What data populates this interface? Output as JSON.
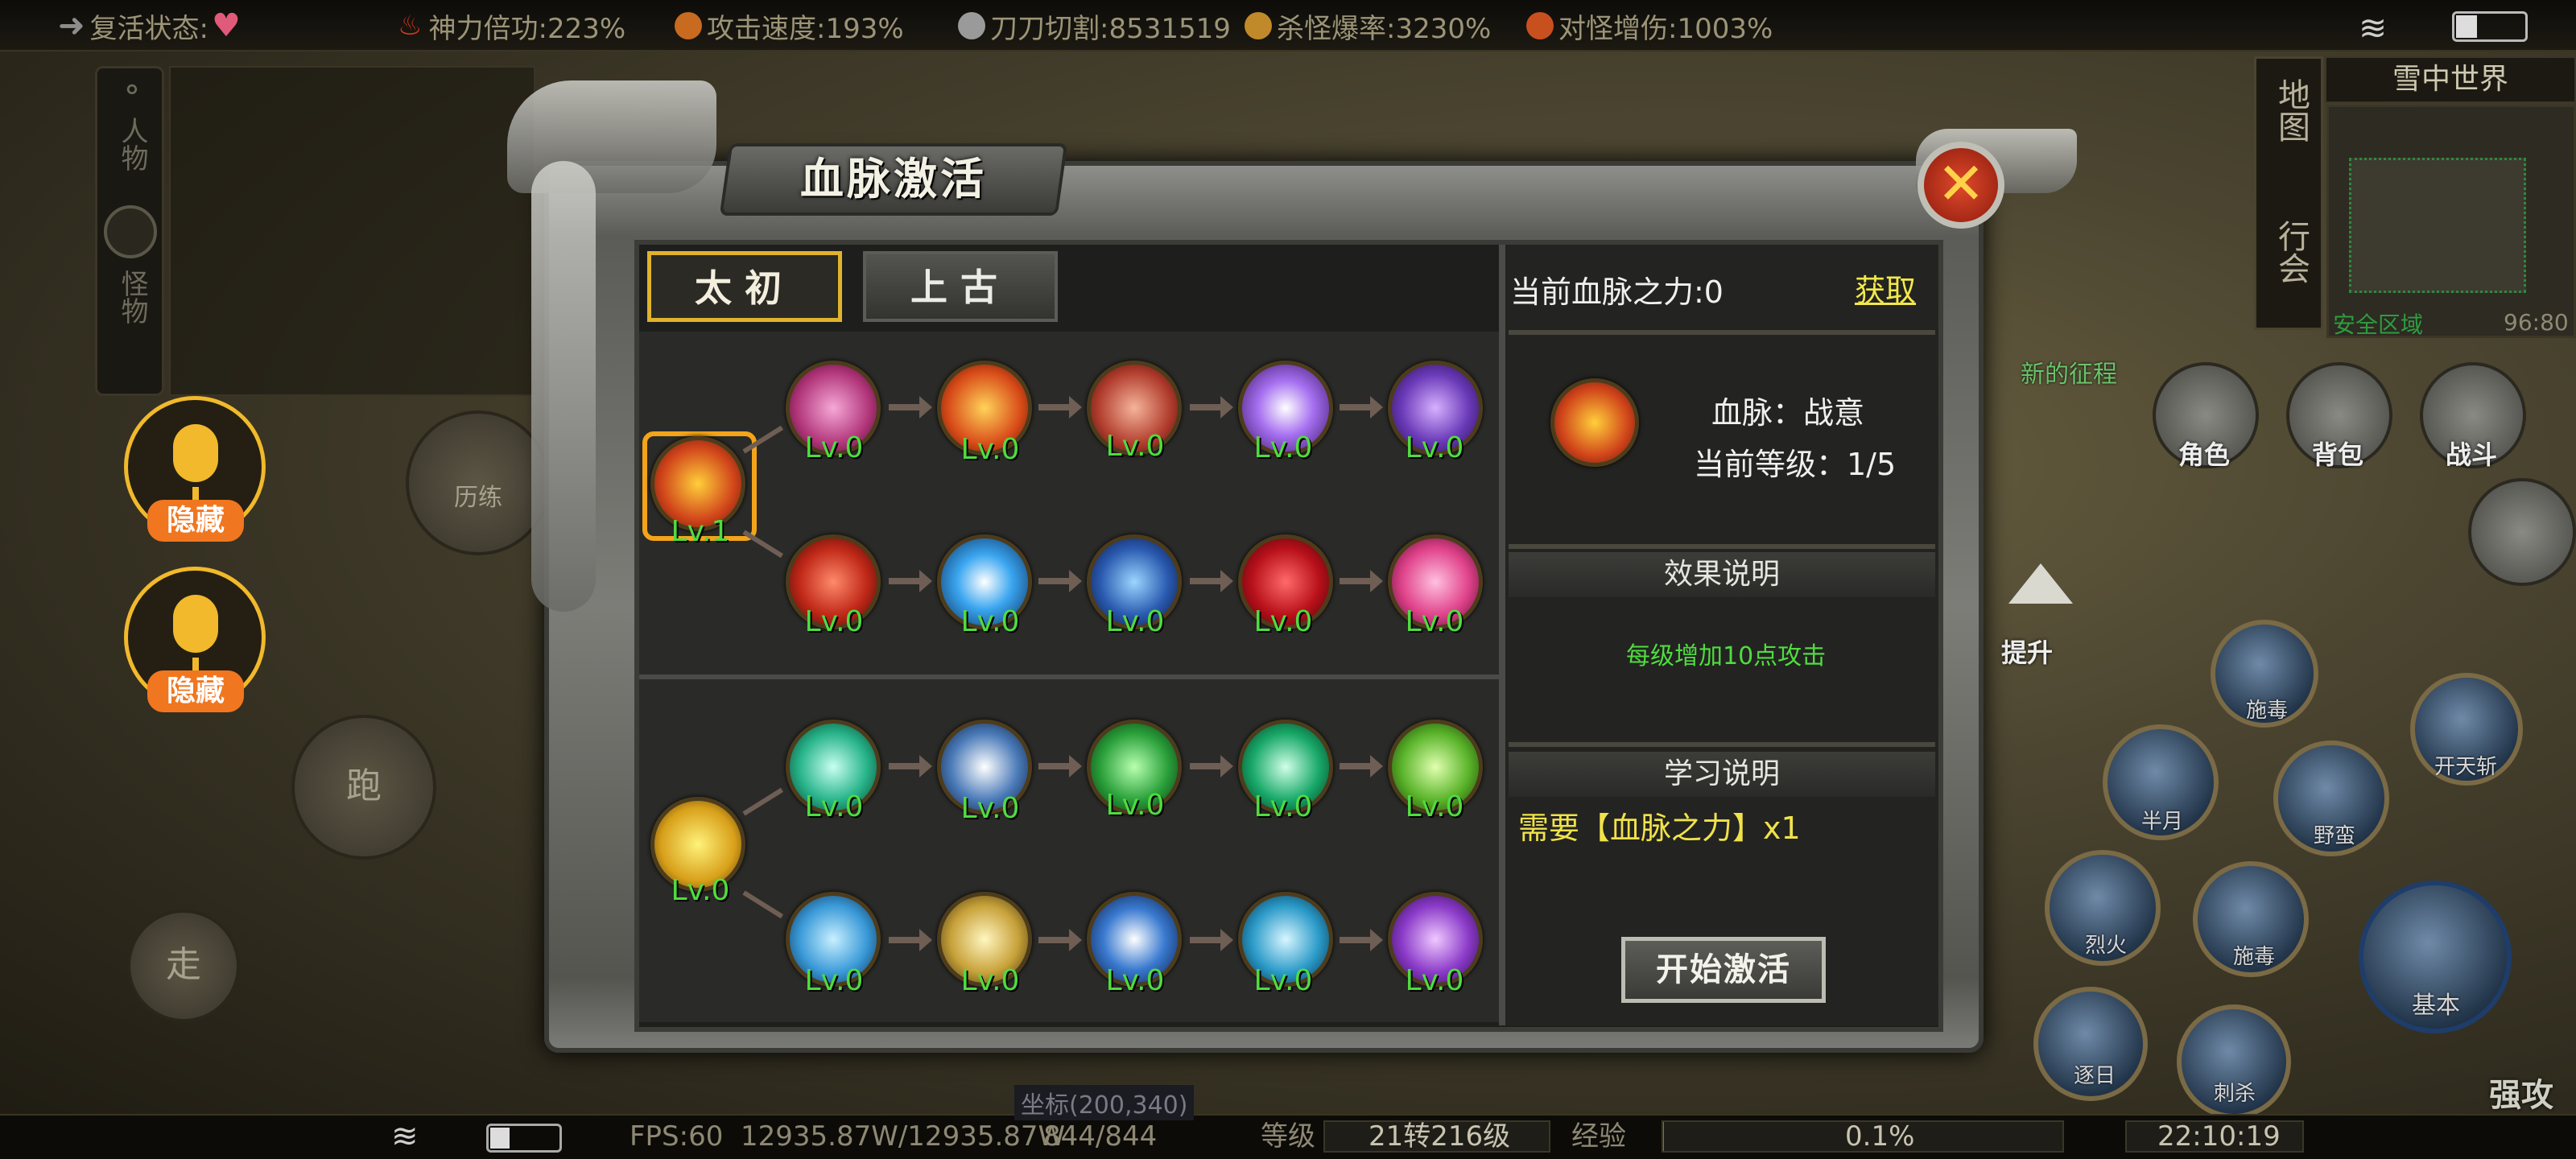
{
  "top_status": {
    "revive_label": "复活状态:",
    "power_label": "神力倍功:223%",
    "atk_speed_label": "攻击速度:193%",
    "cut_label": "刀刀切割:8531519",
    "drop_rate_label": "杀怪爆率:3230%",
    "monster_dmg_label": "对怪增伤:1003%"
  },
  "left_panel": {
    "person_tab": "人物",
    "monster_tab": "怪物",
    "mic_hide_1": "隐藏",
    "mic_hide_2": "隐藏",
    "run_button": "跑",
    "walk_button": "走",
    "history_button": "历练"
  },
  "right_hud": {
    "world_name": "雪中世界",
    "map_tab": "地图",
    "guild_tab": "行会",
    "safe_zone": "安全区域",
    "coords": "96:80",
    "role_label": "角色",
    "bag_label": "背包",
    "fight_label": "战斗",
    "upgrade_label": "提升",
    "skill_labels": [
      "施毒",
      "开天斩",
      "半月",
      "野蛮",
      "烈火",
      "施毒",
      "基本",
      "逐日",
      "刺杀"
    ],
    "strong_attack": "强攻",
    "npc_name": "新的征程"
  },
  "bottom": {
    "fps": "FPS:60",
    "hp": "12935.87W/12935.87W",
    "mp": "844/844",
    "level_label": "等级",
    "level_value": "21转216级",
    "exp_label": "经验",
    "exp_value": "0.1%",
    "exp_fraction": 0.001,
    "time": "22:10:19",
    "coord_hint": "坐标(200,340)"
  },
  "dialog": {
    "title": "血脉激活",
    "tabs": [
      "太初",
      "上古"
    ],
    "active_tab": 0,
    "tree_top": {
      "root_level": "Lv.1",
      "row1_levels": [
        "Lv.0",
        "Lv.0",
        "Lv.0",
        "Lv.0",
        "Lv.0"
      ],
      "row2_levels": [
        "Lv.0",
        "Lv.0",
        "Lv.0",
        "Lv.0",
        "Lv.0"
      ]
    },
    "tree_bottom": {
      "root_level": "Lv.0",
      "row1_levels": [
        "Lv.0",
        "Lv.0",
        "Lv.0",
        "Lv.0",
        "Lv.0"
      ],
      "row2_levels": [
        "Lv.0",
        "Lv.0",
        "Lv.0",
        "Lv.0",
        "Lv.0"
      ]
    },
    "info": {
      "bloodline_power_label": "当前血脉之力:0",
      "obtain_link": "获取",
      "bloodline_name": "血脉：战意",
      "current_level": "当前等级：1/5",
      "effect_header": "效果说明",
      "effect_text": "每级增加10点攻击",
      "learn_header": "学习说明",
      "learn_text": "需要【血脉之力】x1",
      "activate_button": "开始激活"
    }
  },
  "colors": {
    "accent_gold": "#e0b32d",
    "level_green": "#4fdc3f",
    "effect_green": "#4fdc3f",
    "learn_yellow": "#f0e24a",
    "link_yellow": "#f2e84a"
  }
}
